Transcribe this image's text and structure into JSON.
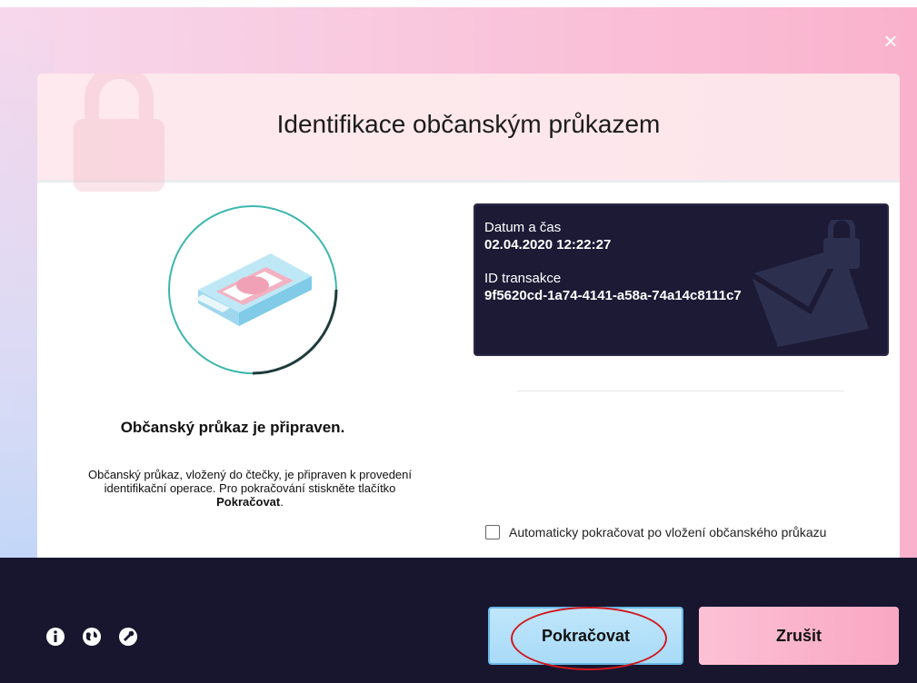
{
  "window": {
    "title": "Identifikace občanským průkazem",
    "close_label": "×"
  },
  "left_panel": {
    "status_title": "Občanský průkaz je připraven.",
    "description_line1": "Občanský průkaz, vložený do čtečky, je připraven k provedení",
    "description_line2": "identifikační operace. Pro pokračování stiskněte tlačítko",
    "description_bold": "Pokračovat",
    "description_end": ".",
    "illustration": "card-reader-icon"
  },
  "info_box": {
    "date_label": "Datum a čas",
    "date_value": "02.04.2020 12:22:27",
    "transaction_label": "ID transakce",
    "transaction_value": "9f5620cd-1a74-4141-a58a-74a14c8111c7"
  },
  "auto_continue": {
    "label": "Automaticky pokračovat po vložení občanského průkazu",
    "checked": false
  },
  "footer": {
    "icons": [
      "info-icon",
      "globe-icon",
      "support-icon"
    ],
    "continue_label": "Pokračovat",
    "cancel_label": "Zrušit"
  },
  "colors": {
    "footer_bg": "#17162e",
    "continue_bg": "#a9dbf8",
    "cancel_bg": "#f9a7c2",
    "highlight_ring": "#d0181e"
  }
}
